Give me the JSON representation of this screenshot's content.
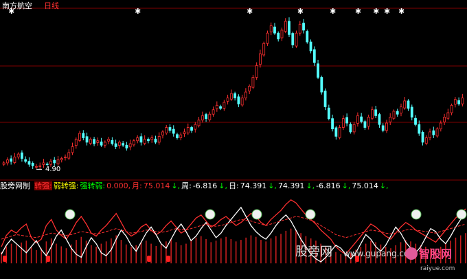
{
  "header": {
    "stock_name": "南方航空",
    "period": "日线"
  },
  "price_panel": {
    "low_label": "4.90"
  },
  "indicator_bar": {
    "items": [
      {
        "text": "股旁网制",
        "color": "#ffffff"
      },
      {
        "text": "转强:",
        "color": "#ff3030"
      },
      {
        "text": "弱转强:",
        "color": "#ffff00"
      },
      {
        "text": "强转弱:",
        "color": "#00ff00"
      },
      {
        "text": "0.000,",
        "color": "#ff3030"
      },
      {
        "text": "月:",
        "color": "#ff3030"
      },
      {
        "text": "75.014",
        "color": "#ff3030"
      },
      {
        "text": "↓,",
        "color": "#00ff00"
      },
      {
        "text": "周:",
        "color": "#ffffff"
      },
      {
        "text": "-6.816",
        "color": "#ffffff"
      },
      {
        "text": "↓,",
        "color": "#00ff00"
      },
      {
        "text": "日:",
        "color": "#ffffff"
      },
      {
        "text": "74.391",
        "color": "#ffffff"
      },
      {
        "text": "↓,",
        "color": "#00ff00"
      },
      {
        "text": "74.391",
        "color": "#ffffff"
      },
      {
        "text": "↓,",
        "color": "#00ff00"
      },
      {
        "text": "-6.816",
        "color": "#ffffff"
      },
      {
        "text": "↓,",
        "color": "#00ff00"
      },
      {
        "text": "75.014",
        "color": "#ffffff"
      },
      {
        "text": "↓,",
        "color": "#00ff00"
      }
    ]
  },
  "watermarks": {
    "site_cn": "股旁网",
    "site_en": "www.gupang.com",
    "logo_cn": "智股网",
    "logo_en": "raiyue.com"
  },
  "colors": {
    "background": "#000000",
    "up": "#ff3030",
    "down": "#54ffff",
    "grid": "#800000",
    "marker": "#ffffff"
  },
  "chart_data": [
    {
      "type": "candlestick",
      "title": "南方航空 日线",
      "min_price_label": "4.90",
      "close": [
        5.2,
        5.4,
        5.3,
        5.6,
        5.8,
        5.5,
        5.3,
        5.1,
        5.0,
        4.95,
        5.0,
        5.2,
        5.1,
        5.3,
        5.2,
        5.4,
        5.5,
        5.6,
        5.9,
        6.3,
        6.8,
        7.2,
        6.9,
        6.6,
        6.8,
        6.5,
        6.7,
        6.4,
        6.6,
        6.8,
        6.5,
        6.3,
        6.6,
        6.4,
        6.2,
        6.5,
        6.7,
        6.9,
        6.6,
        6.8,
        6.7,
        6.9,
        6.6,
        7.0,
        7.3,
        7.6,
        7.4,
        7.2,
        6.9,
        7.1,
        7.3,
        7.6,
        7.4,
        7.8,
        8.1,
        8.4,
        8.2,
        8.5,
        8.8,
        9.1,
        8.9,
        9.3,
        9.6,
        9.9,
        9.6,
        9.2,
        9.6,
        10.0,
        10.4,
        11.0,
        11.8,
        12.6,
        13.3,
        14.0,
        14.5,
        14.0,
        13.6,
        14.2,
        14.8,
        13.9,
        13.2,
        14.0,
        14.6,
        14.2,
        13.4,
        12.8,
        12.0,
        11.0,
        10.0,
        9.0,
        8.2,
        7.5,
        7.0,
        7.6,
        8.2,
        7.9,
        7.3,
        7.8,
        8.4,
        8.0,
        7.6,
        8.3,
        8.8,
        8.4,
        7.8,
        7.4,
        7.9,
        8.3,
        8.7,
        8.5,
        9.0,
        9.4,
        8.9,
        8.3,
        7.8,
        7.2,
        6.6,
        6.9,
        7.3,
        7.1,
        7.5,
        7.9,
        8.3,
        8.6,
        9.1,
        9.5,
        9.2,
        9.6
      ],
      "open_offset_note": "",
      "ylim": [
        4.5,
        15.5
      ],
      "star_markers_at": [
        2,
        37,
        68,
        82,
        91,
        98,
        103,
        106,
        110
      ]
    },
    {
      "type": "line",
      "series": [
        {
          "color": "#ff3030",
          "values": [
            30,
            45,
            52,
            48,
            55,
            60,
            42,
            35,
            40,
            58,
            66,
            52,
            45,
            40,
            50,
            62,
            70,
            60,
            48,
            44,
            52,
            58,
            66,
            74,
            62,
            50,
            44,
            48,
            56,
            60,
            52,
            46,
            50,
            58,
            64,
            56,
            48,
            52,
            60,
            68,
            72,
            64,
            56,
            60,
            66,
            70,
            64,
            58,
            62,
            68,
            74,
            70,
            62,
            58,
            66,
            72,
            78,
            86,
            92,
            88,
            80,
            72,
            66,
            60,
            52,
            46,
            40,
            30,
            24,
            20,
            28,
            36,
            44,
            52,
            60,
            56,
            50,
            44,
            40,
            48,
            56,
            62,
            58,
            52,
            48,
            44,
            40,
            36,
            44,
            52,
            60,
            68,
            74,
            80
          ]
        },
        {
          "color": "#ffffff",
          "values": [
            20,
            32,
            40,
            34,
            28,
            22,
            30,
            38,
            26,
            18,
            30,
            44,
            52,
            40,
            28,
            20,
            16,
            30,
            42,
            34,
            22,
            18,
            26,
            40,
            52,
            44,
            32,
            24,
            36,
            48,
            56,
            46,
            34,
            28,
            40,
            52,
            60,
            50,
            38,
            44,
            54,
            62,
            52,
            42,
            48,
            58,
            66,
            74,
            82,
            70,
            58,
            50,
            44,
            40,
            48,
            58,
            66,
            72,
            64,
            52,
            40,
            30,
            20,
            14,
            10,
            16,
            24,
            32,
            28,
            20,
            14,
            22,
            34,
            46,
            40,
            30,
            24,
            32,
            44,
            56,
            48,
            36,
            28,
            22,
            30,
            42,
            54,
            50,
            40,
            34,
            44,
            56,
            66,
            72
          ]
        },
        {
          "color": "#ff3030",
          "values": [
            40,
            42,
            44,
            46,
            45,
            44,
            43,
            42,
            44,
            46,
            48,
            47,
            46,
            45,
            46,
            48,
            50,
            49,
            48,
            47,
            48,
            50,
            52,
            54,
            52,
            50,
            48,
            49,
            50,
            52,
            51,
            50,
            49,
            50,
            52,
            54,
            53,
            52,
            54,
            56,
            58,
            60,
            58,
            57,
            58,
            60,
            62,
            64,
            66,
            65,
            64,
            62,
            60,
            58,
            60,
            62,
            64,
            66,
            68,
            70,
            69,
            67,
            65,
            62,
            58,
            54,
            50,
            46,
            44,
            42,
            44,
            46,
            48,
            50,
            52,
            51,
            50,
            48,
            47,
            48,
            50,
            52,
            53,
            52,
            51,
            50,
            49,
            48,
            50,
            52,
            54,
            56,
            58,
            60
          ]
        }
      ],
      "ylim": [
        0,
        100
      ]
    }
  ]
}
